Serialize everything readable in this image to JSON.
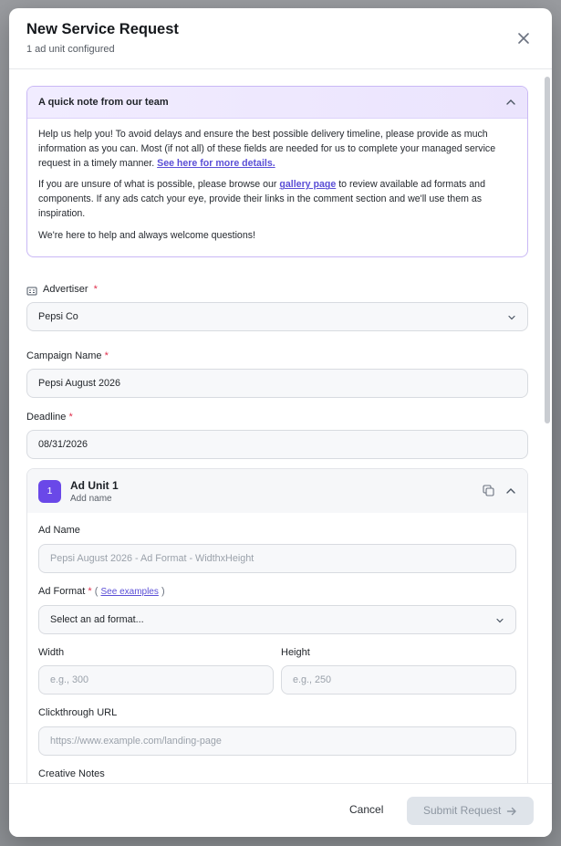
{
  "modal": {
    "title": "New Service Request",
    "subtitle": "1 ad unit configured"
  },
  "note": {
    "title": "A quick note from our team",
    "p1": "Help us help you! To avoid delays and ensure the best possible delivery timeline, please provide as much information as you can. Most (if not all) of these fields are needed for us to complete your managed service request in a timely manner.",
    "p1_link": "See here for more details.",
    "p2_a": "If you are unsure of what is possible, please browse our",
    "p2_link": "gallery page",
    "p2_b": "to review available ad formats and components. If any ads catch your eye, provide their links in the comment section and we'll use them as inspiration.",
    "p3": "We're here to help and always welcome questions!"
  },
  "form": {
    "advertiser_label": "Advertiser",
    "advertiser_value": "Pepsi Co",
    "campaign_label": "Campaign Name",
    "campaign_value": "Pepsi August 2026",
    "deadline_label": "Deadline",
    "deadline_value": "08/31/2026",
    "required_mark": "*"
  },
  "ad_unit": {
    "number": "1",
    "title": "Ad Unit 1",
    "subtitle": "Add name",
    "ad_name_label": "Ad Name",
    "ad_name_placeholder": "Pepsi August 2026 - Ad Format - WidthxHeight",
    "ad_format_label": "Ad Format",
    "ad_format_paren_open": "(",
    "ad_format_link": "See examples",
    "ad_format_paren_close": ")",
    "ad_format_value": "Select an ad format...",
    "width_label": "Width",
    "width_placeholder": "e.g., 300",
    "height_label": "Height",
    "height_placeholder": "e.g., 250",
    "clickthrough_label": "Clickthrough URL",
    "clickthrough_placeholder": "https://www.example.com/landing-page",
    "creative_notes_label": "Creative Notes"
  },
  "footer": {
    "cancel_label": "Cancel",
    "submit_label": "Submit Request"
  },
  "colors": {
    "accent": "#6a48e8",
    "link": "#5b4fd6",
    "required": "#e0304d"
  }
}
